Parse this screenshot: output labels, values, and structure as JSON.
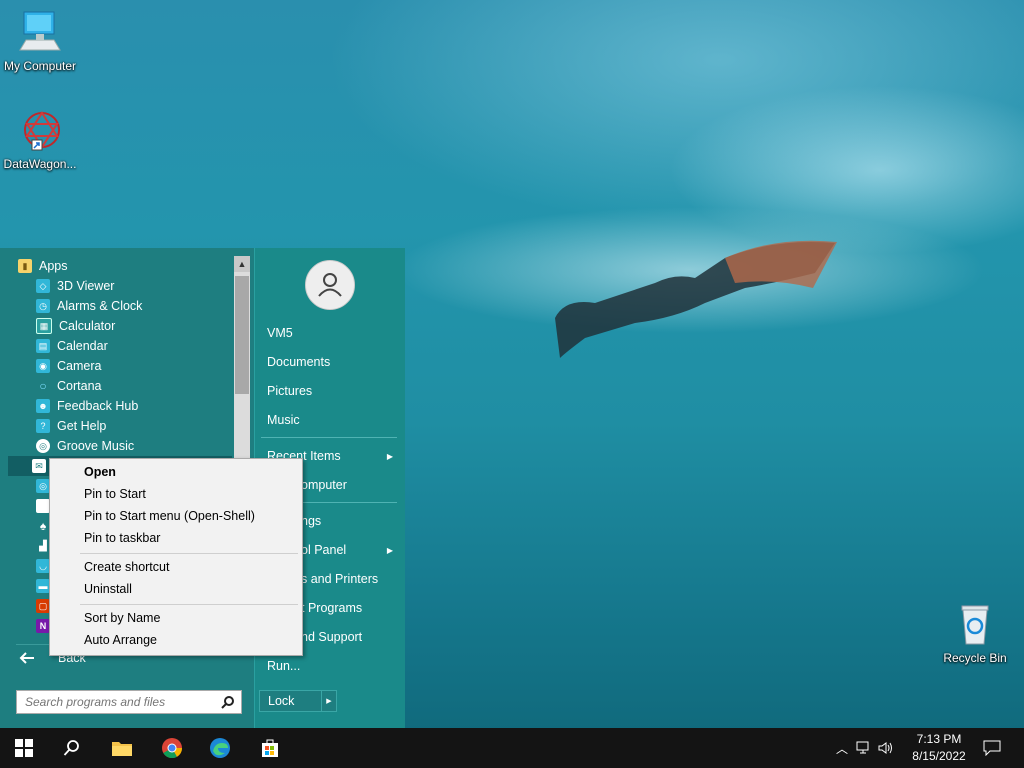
{
  "desktop": {
    "icons": [
      {
        "label": "My Computer"
      },
      {
        "label": "DataWagon..."
      },
      {
        "label": "Recycle Bin"
      }
    ]
  },
  "start_menu": {
    "apps_header": "Apps",
    "apps": [
      {
        "label": "3D Viewer",
        "icon": "cube-icon"
      },
      {
        "label": "Alarms & Clock",
        "icon": "clock-icon"
      },
      {
        "label": "Calculator",
        "icon": "calculator-icon"
      },
      {
        "label": "Calendar",
        "icon": "calendar-icon"
      },
      {
        "label": "Camera",
        "icon": "camera-icon"
      },
      {
        "label": "Cortana",
        "icon": "cortana-icon"
      },
      {
        "label": "Feedback Hub",
        "icon": "feedback-icon"
      },
      {
        "label": "Get Help",
        "icon": "help-icon"
      },
      {
        "label": "Groove Music",
        "icon": "music-icon"
      }
    ],
    "back_label": "Back",
    "search_placeholder": "Search programs and files",
    "right_items": [
      {
        "label": "VM5",
        "submenu": false
      },
      {
        "label": "Documents",
        "submenu": false
      },
      {
        "label": "Pictures",
        "submenu": false
      },
      {
        "label": "Music",
        "submenu": false
      },
      {
        "label": "Recent Items",
        "submenu": true
      },
      {
        "label": "omputer",
        "submenu": false
      },
      {
        "label": "ngs",
        "submenu": false
      },
      {
        "label": "ol Panel",
        "submenu": true
      },
      {
        "label": "s and Printers",
        "submenu": false
      },
      {
        "label": "t Programs",
        "submenu": false
      },
      {
        "label": "nd Support",
        "submenu": false
      },
      {
        "label": "Run...",
        "submenu": false
      }
    ],
    "lock_label": "Lock"
  },
  "context_menu": {
    "items": [
      {
        "label": "Open",
        "bold": true
      },
      {
        "label": "Pin to Start"
      },
      {
        "label": "Pin to Start menu (Open-Shell)"
      },
      {
        "label": "Pin to taskbar"
      },
      {
        "label": "Create shortcut"
      },
      {
        "label": "Uninstall"
      },
      {
        "label": "Sort by Name"
      },
      {
        "label": "Auto Arrange"
      }
    ]
  },
  "taskbar": {
    "time": "7:13 PM",
    "date": "8/15/2022"
  },
  "colors": {
    "start_menu_bg": "#1e7e80",
    "taskbar_bg": "#141414",
    "context_bg": "#f2f2f2"
  }
}
